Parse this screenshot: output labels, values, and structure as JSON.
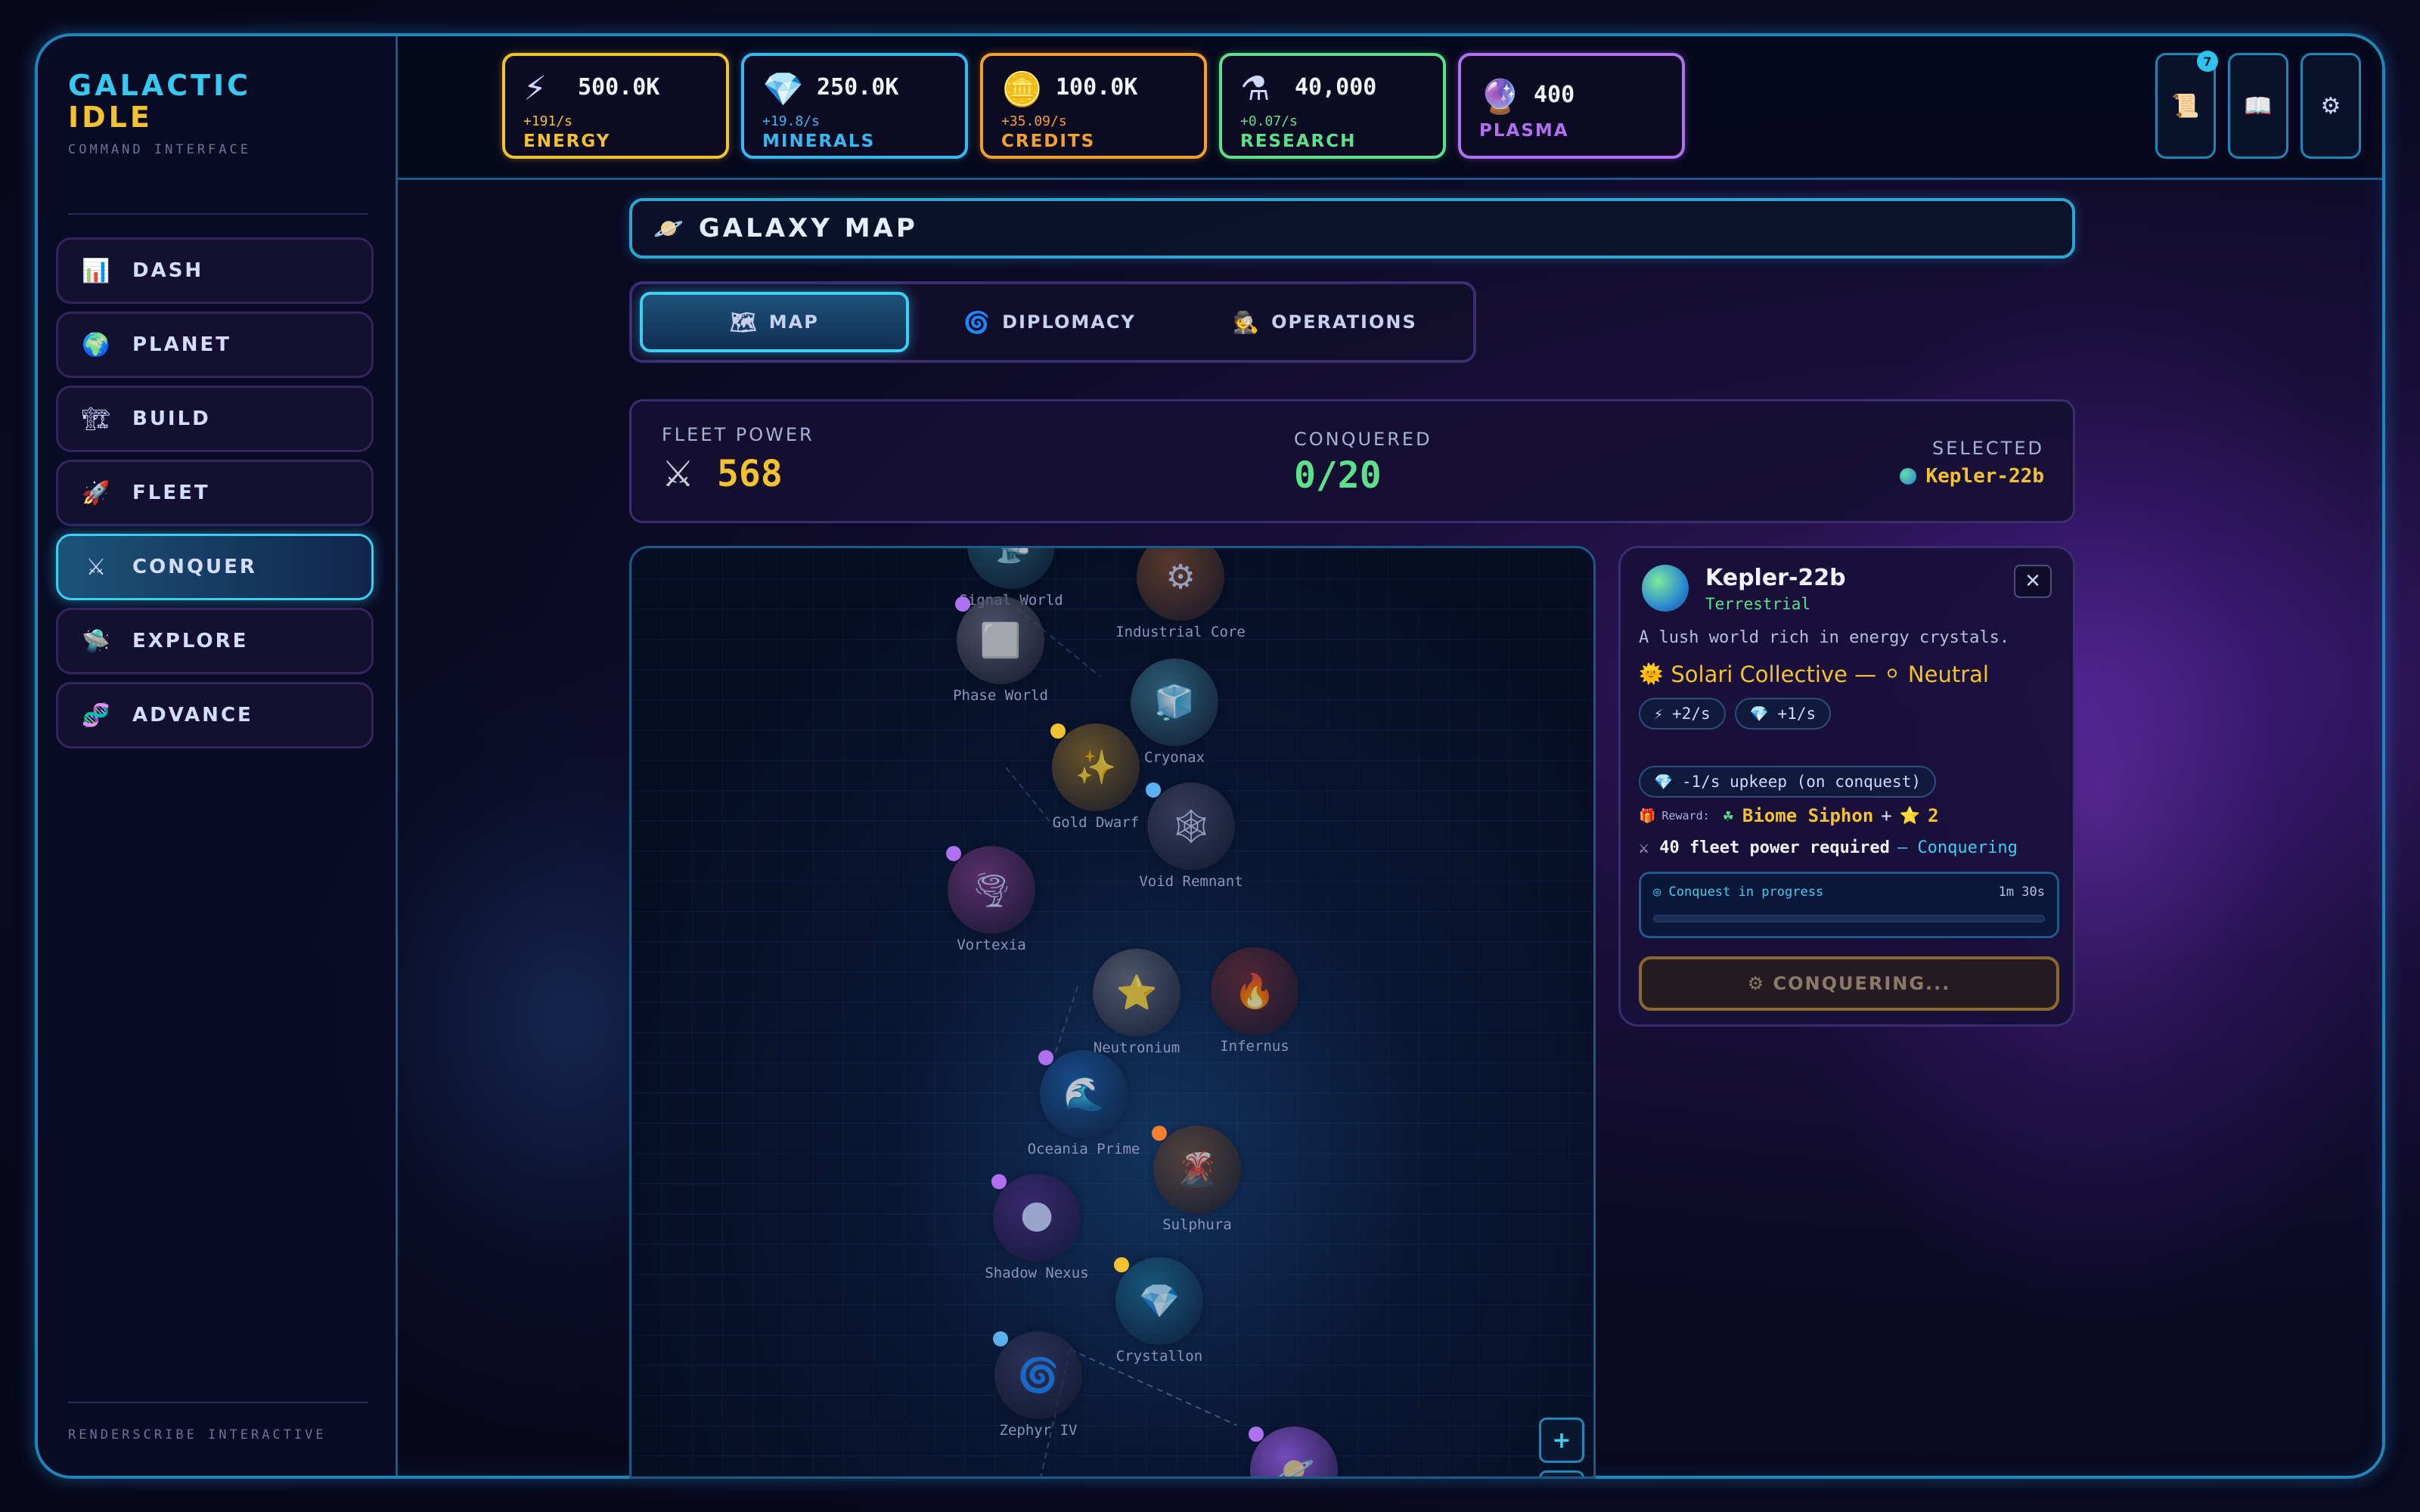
{
  "brand": {
    "line1": "GALACTIC",
    "line2": "IDLE",
    "sub": "COMMAND INTERFACE"
  },
  "sidebar": {
    "items": [
      {
        "label": "DASH",
        "icon": "bar-chart-icon",
        "glyph": "📊",
        "active": false
      },
      {
        "label": "PLANET",
        "icon": "earth-icon",
        "glyph": "🌍",
        "active": false
      },
      {
        "label": "BUILD",
        "icon": "crane-icon",
        "glyph": "🏗",
        "active": false
      },
      {
        "label": "FLEET",
        "icon": "rocket-icon",
        "glyph": "🚀",
        "active": false
      },
      {
        "label": "CONQUER",
        "icon": "crossed-swords-icon",
        "glyph": "⚔",
        "active": true
      },
      {
        "label": "EXPLORE",
        "icon": "ufo-icon",
        "glyph": "🛸",
        "active": false
      },
      {
        "label": "ADVANCE",
        "icon": "dna-icon",
        "glyph": "🧬",
        "active": false
      }
    ],
    "footer": "RENDERSCRIBE INTERACTIVE"
  },
  "resources": [
    {
      "name": "ENERGY",
      "value": "500.0K",
      "rate": "+191/s",
      "icon": "lightning-icon",
      "glyph": "⚡",
      "color": "#f2c230"
    },
    {
      "name": "MINERALS",
      "value": "250.0K",
      "rate": "+19.8/s",
      "icon": "crystal-icon",
      "glyph": "💎",
      "color": "#38b8f0"
    },
    {
      "name": "CREDITS",
      "value": "100.0K",
      "rate": "+35.09/s",
      "icon": "coin-icon",
      "glyph": "🪙",
      "color": "#f2a030"
    },
    {
      "name": "RESEARCH",
      "value": "40,000",
      "rate": "+0.07/s",
      "icon": "flask-icon",
      "glyph": "⚗",
      "color": "#5ce08a"
    },
    {
      "name": "PLASMA",
      "value": "400",
      "rate": "",
      "icon": "plasma-orb-icon",
      "glyph": "🔮",
      "color": "#b070f0"
    }
  ],
  "top_buttons": {
    "quests": {
      "glyph": "📜",
      "badge": "7"
    },
    "codex": {
      "glyph": "📖"
    },
    "settings": {
      "glyph": "⚙"
    }
  },
  "page": {
    "title": "GALAXY MAP",
    "title_glyph": "🪐"
  },
  "tabs": [
    {
      "label": "MAP",
      "glyph": "🗺",
      "active": true
    },
    {
      "label": "DIPLOMACY",
      "glyph": "🌀",
      "active": false
    },
    {
      "label": "OPERATIONS",
      "glyph": "🕵",
      "active": false
    }
  ],
  "stats": {
    "fleet_power_label": "FLEET POWER",
    "fleet_power": "568",
    "fleet_glyph": "⚔",
    "conquered_label": "CONQUERED",
    "conquered": "0/20",
    "selected_label": "SELECTED",
    "selected": "Kepler-22b"
  },
  "map": {
    "planets": [
      {
        "name": "Signal World",
        "glyph": "📡",
        "color": "#2a6a80",
        "dot": null
      },
      {
        "name": "Industrial Core",
        "glyph": "⚙",
        "color": "#7a4a30",
        "dot": null
      },
      {
        "name": "Phase World",
        "glyph": "⬜",
        "color": "#6a6a80",
        "dot": "#b070f0"
      },
      {
        "name": "Cryonax",
        "glyph": "🧊",
        "color": "#3a7a90",
        "dot": null
      },
      {
        "name": "Gold Dwarf",
        "glyph": "✨",
        "color": "#8a6a2a",
        "dot": "#f2c230"
      },
      {
        "name": "Void Remnant",
        "glyph": "🕸",
        "color": "#4a4a68",
        "dot": "#5ab0f0"
      },
      {
        "name": "Vortexia",
        "glyph": "🌪",
        "color": "#7a3a80",
        "dot": "#b070f0"
      },
      {
        "name": "Neutronium",
        "glyph": "⭐",
        "color": "#6a6a7a",
        "dot": null
      },
      {
        "name": "Infernus",
        "glyph": "🔥",
        "color": "#6a2a30",
        "dot": null
      },
      {
        "name": "Oceania Prime",
        "glyph": "🌊",
        "color": "#1a5aa0",
        "dot": "#b070f0"
      },
      {
        "name": "Sulphura",
        "glyph": "🌋",
        "color": "#6a4a30",
        "dot": "#f28030"
      },
      {
        "name": "Shadow Nexus",
        "glyph": "🌑",
        "color": "#4a2a80",
        "dot": "#b070f0"
      },
      {
        "name": "Crystallon",
        "glyph": "💎",
        "color": "#1a6a90",
        "dot": "#f2c230"
      },
      {
        "name": "Zephyr IV",
        "glyph": "🌀",
        "color": "#3a3a60",
        "dot": "#5ab0f0"
      },
      {
        "name": "",
        "glyph": "🪐",
        "color": "#a060f0",
        "dot": "#b070f0"
      }
    ],
    "zoom_in": "+"
  },
  "detail": {
    "name": "Kepler-22b",
    "type": "Terrestrial",
    "description": "A lush world rich in energy crystals.",
    "faction": "Solari Collective — ",
    "stance": "Neutral",
    "faction_glyph": "🌞",
    "stance_glyph": "⚪",
    "yields": [
      {
        "text": "+2/s",
        "glyph": "⚡"
      },
      {
        "text": "+1/s",
        "glyph": "💎"
      }
    ],
    "upkeep": "-1/s upkeep (on conquest)",
    "upkeep_glyph": "💎",
    "reward_label": "Reward:",
    "reward_glyph": "🎁",
    "reward_item_glyph": "☘",
    "reward_item": "Biome Siphon",
    "reward_plus": "+",
    "reward_star_glyph": "⭐",
    "reward_stars": "2",
    "requirement": "40 fleet power required",
    "requirement_glyph": "⚔",
    "status": "— Conquering",
    "progress_label": "Conquest in progress",
    "progress_time": "1m 30s",
    "progress_fraction": 0.0,
    "action": "⚙ CONQUERING..."
  }
}
